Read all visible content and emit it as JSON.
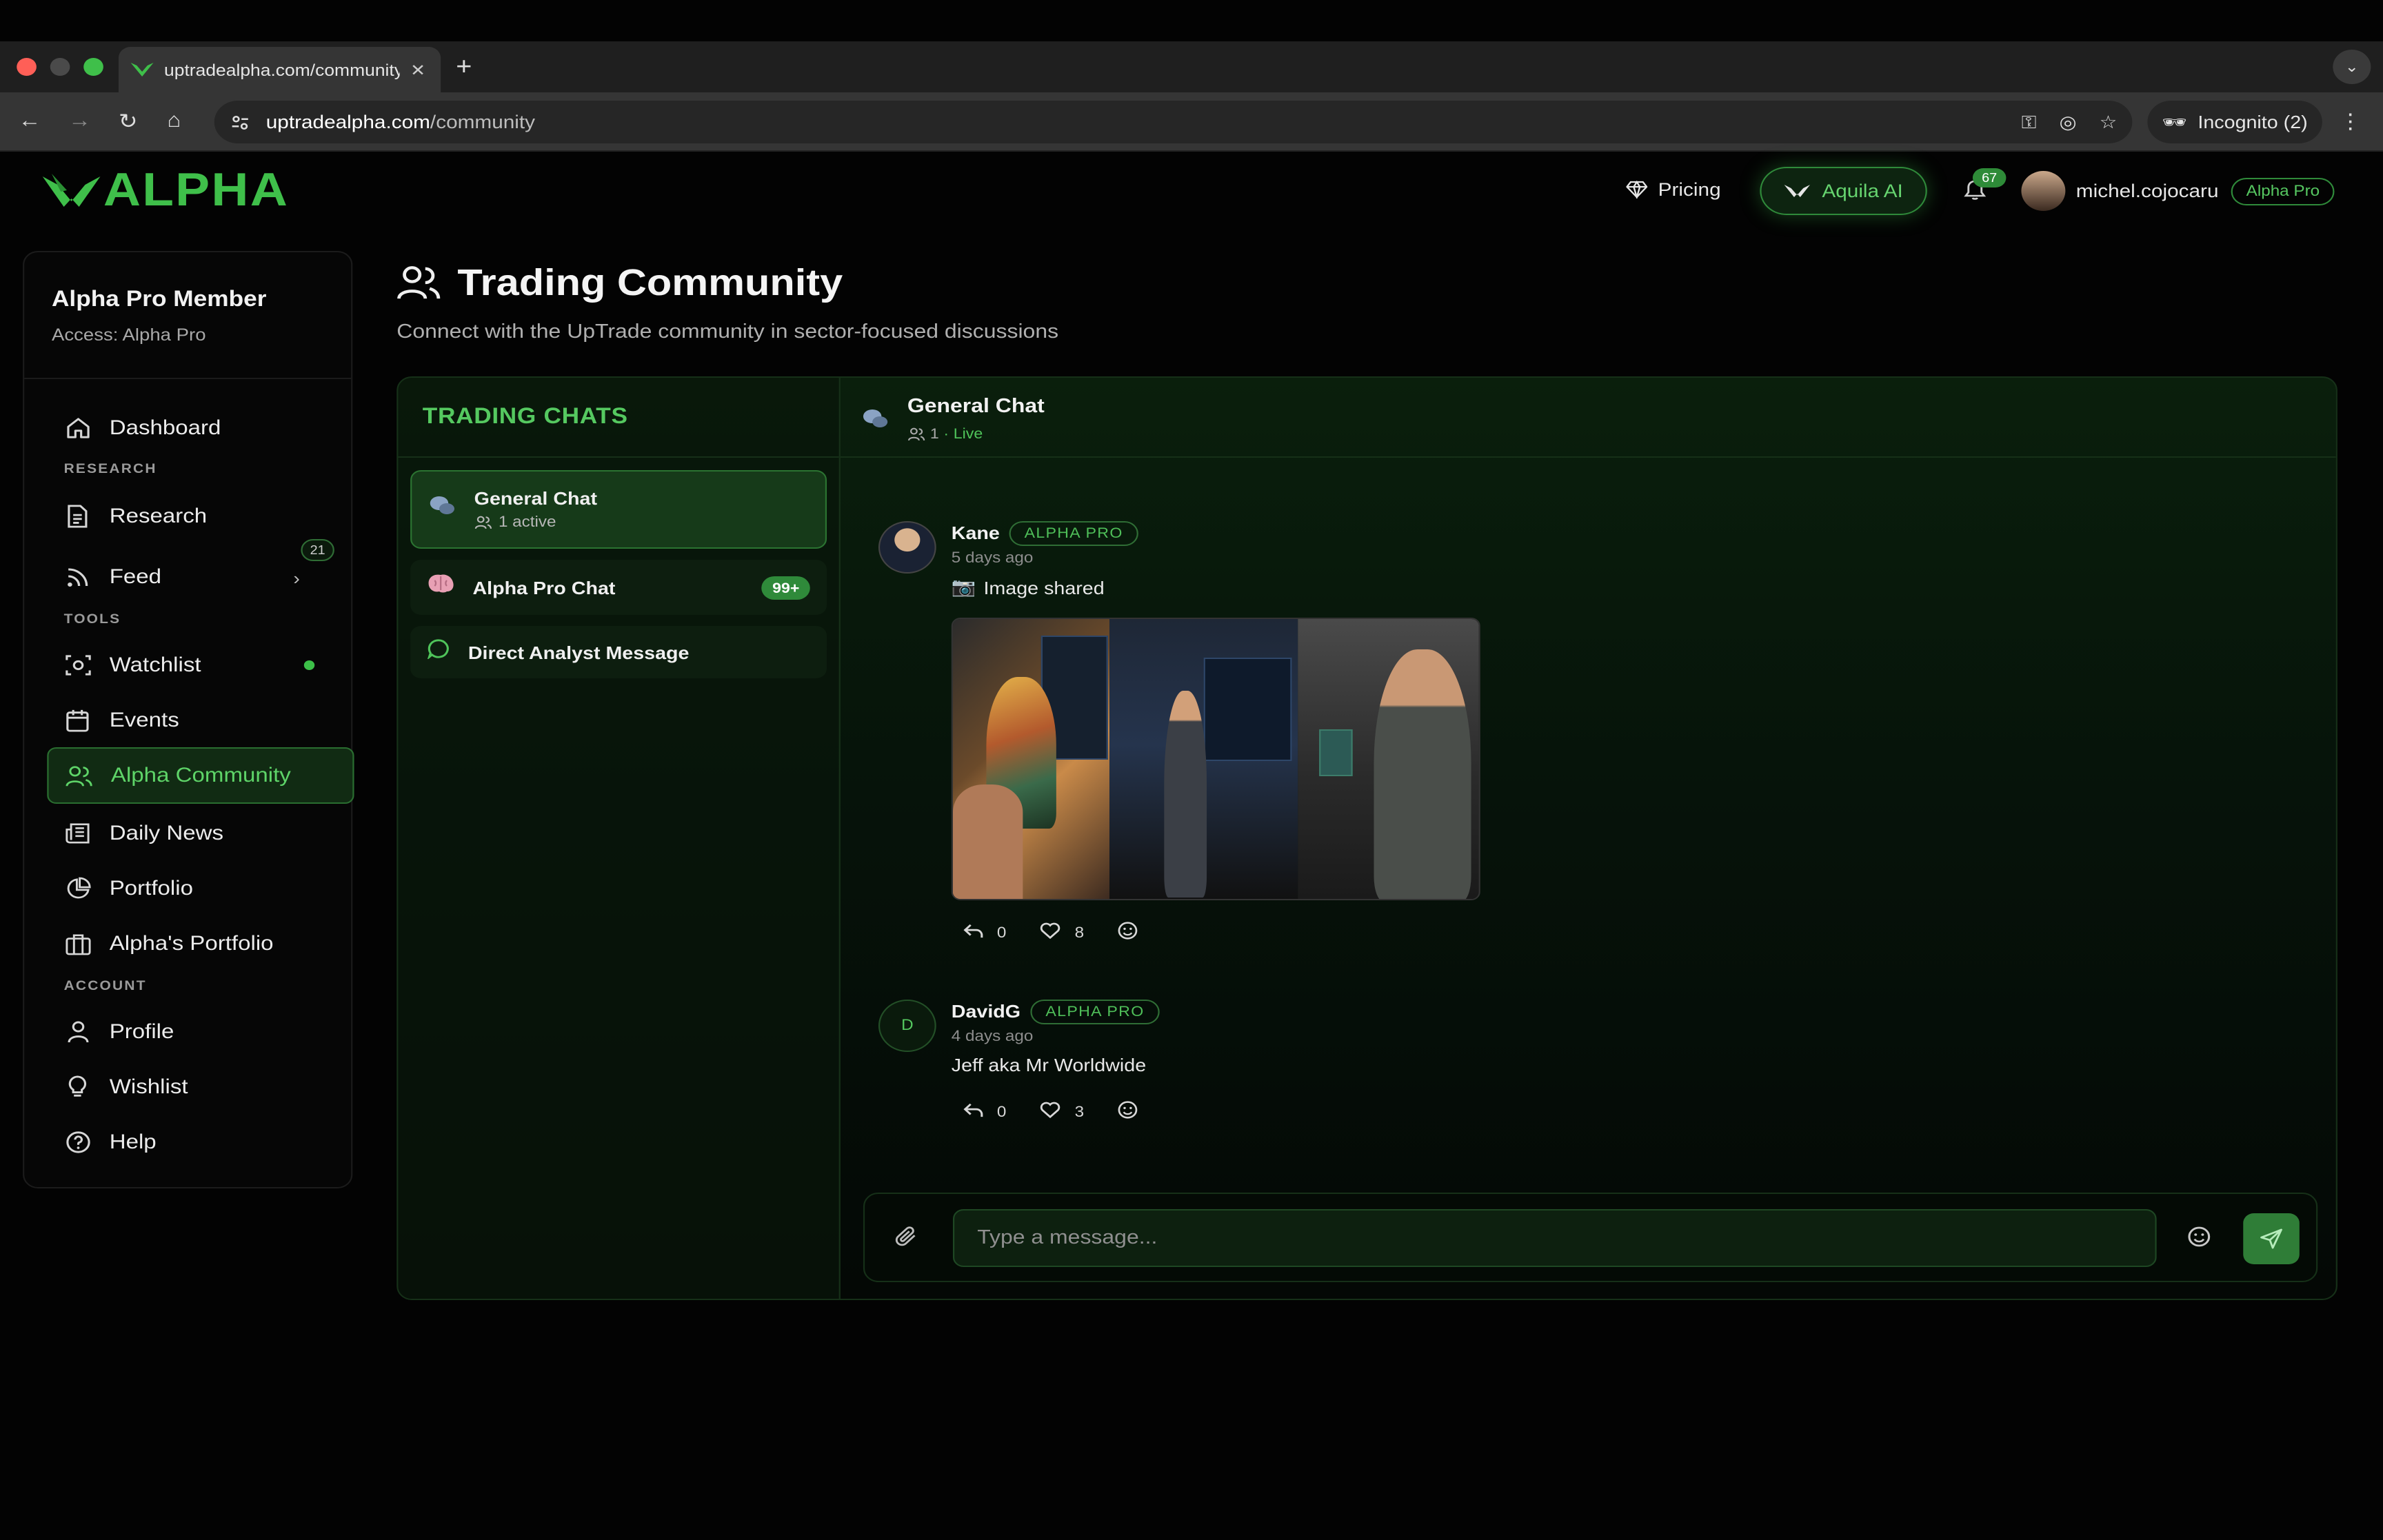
{
  "browser": {
    "tab_title": "uptradealpha.com/community",
    "url_host": "uptradealpha.com",
    "url_path": "/community",
    "incognito_label": "Incognito (2)"
  },
  "header": {
    "logo_text": "ALPHA",
    "pricing_label": "Pricing",
    "aquila_label": "Aquila AI",
    "notification_count": "67",
    "username": "michel.cojocaru",
    "tier_badge": "Alpha Pro",
    "accent_color": "#3fbf4a"
  },
  "sidebar": {
    "title": "Alpha Pro Member",
    "subtitle": "Access: Alpha Pro",
    "sections": {
      "research": "RESEARCH",
      "tools": "TOOLS",
      "account": "ACCOUNT"
    },
    "items": [
      {
        "label": "Dashboard",
        "icon": "home-icon"
      },
      {
        "label": "Research",
        "icon": "document-icon"
      },
      {
        "label": "Feed",
        "icon": "rss-icon",
        "badge": "21"
      },
      {
        "label": "Watchlist",
        "icon": "eye-scan-icon"
      },
      {
        "label": "Events",
        "icon": "calendar-icon"
      },
      {
        "label": "Alpha Community",
        "icon": "users-icon",
        "active": true
      },
      {
        "label": "Daily News",
        "icon": "newspaper-icon"
      },
      {
        "label": "Portfolio",
        "icon": "pie-chart-icon"
      },
      {
        "label": "Alpha's Portfolio",
        "icon": "briefcase-icon"
      },
      {
        "label": "Profile",
        "icon": "user-icon"
      },
      {
        "label": "Wishlist",
        "icon": "lightbulb-icon"
      },
      {
        "label": "Help",
        "icon": "help-circle-icon"
      }
    ]
  },
  "page": {
    "title": "Trading Community",
    "subtitle": "Connect with the UpTrade community in sector-focused discussions"
  },
  "chats": {
    "heading": "TRADING CHATS",
    "list": [
      {
        "name": "General Chat",
        "sub": "1 active",
        "icon": "speech-bubbles-icon"
      },
      {
        "name": "Alpha Pro Chat",
        "badge": "99+",
        "icon": "brain-icon"
      },
      {
        "name": "Direct Analyst Message",
        "icon": "chat-bubble-icon"
      }
    ]
  },
  "conversation": {
    "title": "General Chat",
    "member_count": "1",
    "status": "Live",
    "messages": [
      {
        "author": "Kane",
        "badge": "ALPHA PRO",
        "time": "5 days ago",
        "text": "Image shared",
        "replies": "0",
        "likes": "8"
      },
      {
        "author": "DavidG",
        "avatar_letter": "D",
        "badge": "ALPHA PRO",
        "time": "4 days ago",
        "text": "Jeff aka Mr Worldwide",
        "replies": "0",
        "likes": "3"
      }
    ]
  },
  "composer": {
    "placeholder": "Type a message..."
  }
}
